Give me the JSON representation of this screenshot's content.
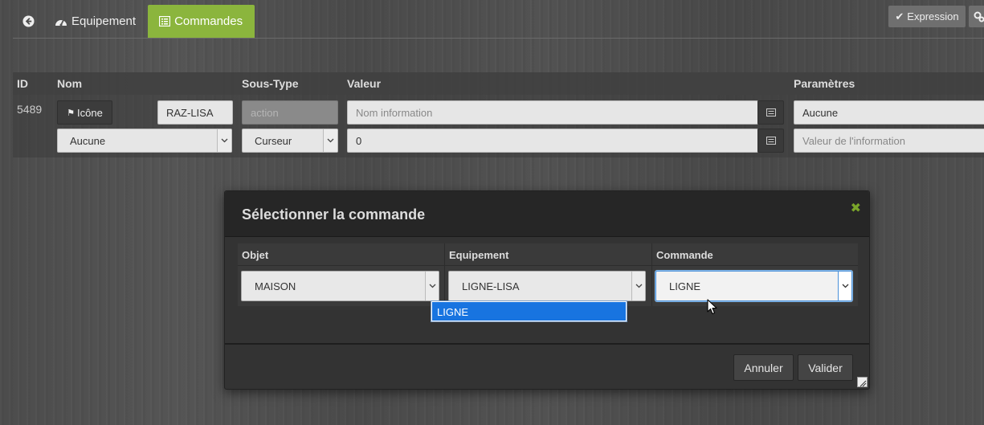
{
  "nav": {
    "equipement_label": "Equipement",
    "commandes_label": "Commandes",
    "expression_label": "Expression"
  },
  "table": {
    "headers": {
      "id": "ID",
      "nom": "Nom",
      "sous_type": "Sous-Type",
      "valeur": "Valeur",
      "parametres": "Paramètres"
    },
    "row": {
      "id": "5489",
      "icone_label": "Icône",
      "name_value": "RAZ-LISA",
      "type_value": "action",
      "value_placeholder": "Nom information",
      "param_value": "Aucune",
      "object_select": "Aucune",
      "subtype_select": "Curseur",
      "value2": "0",
      "param_placeholder": "Valeur de l'information"
    }
  },
  "modal": {
    "title": "Sélectionner la commande",
    "columns": {
      "objet": "Objet",
      "equipement": "Equipement",
      "commande": "Commande"
    },
    "selects": {
      "objet": "MAISON",
      "equipement": "LIGNE-LISA",
      "commande": "LIGNE"
    },
    "dropdown_options": [
      "LIGNE"
    ],
    "cancel_label": "Annuler",
    "validate_label": "Valider"
  },
  "colors": {
    "accent": "#8bb53d",
    "selection": "#1874e0"
  }
}
